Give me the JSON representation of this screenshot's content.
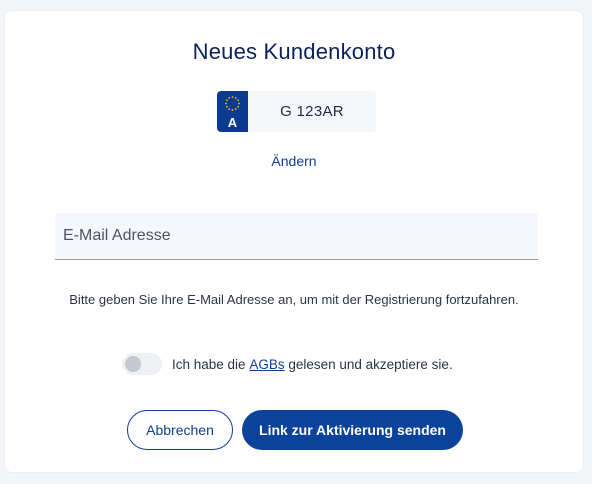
{
  "title": "Neues Kundenkonto",
  "plate": {
    "country_code": "A",
    "number": "G 123AR",
    "band_color": "#0a3b91",
    "star_color": "#f5c400",
    "icon": "eu-stars-icon"
  },
  "change_link": "Ändern",
  "email": {
    "placeholder": "E-Mail Adresse",
    "value": ""
  },
  "hint": "Bitte geben Sie Ihre E-Mail Adresse an, um mit der Registrierung fortzufahren.",
  "agb": {
    "toggle_on": false,
    "text_before": "Ich habe die ",
    "link": "AGBs",
    "text_after": " gelesen und akzeptiere sie."
  },
  "buttons": {
    "cancel": "Abbrechen",
    "send": "Link zur Aktivierung senden"
  },
  "colors": {
    "accent": "#123e8f",
    "primary_button": "#0a4399",
    "title": "#0b2159"
  }
}
